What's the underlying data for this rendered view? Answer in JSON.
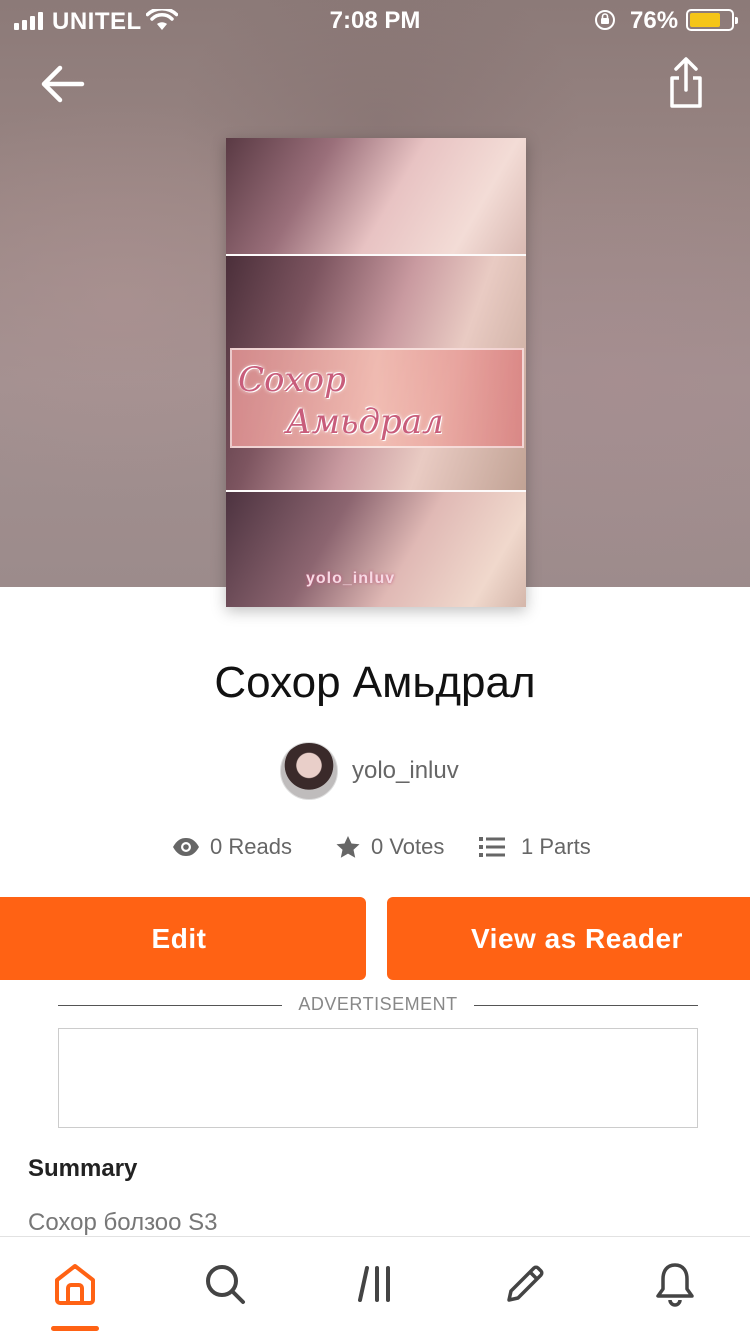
{
  "status_bar": {
    "carrier": "UNITEL",
    "time": "7:08 PM",
    "battery_percent": "76%",
    "battery_level": 0.76
  },
  "header": {
    "back_icon": "arrow-left-icon",
    "share_icon": "share-icon"
  },
  "cover": {
    "title_line_1": "Сохор",
    "title_line_2": "Амьдрал",
    "author_mark": "yolo_inluv"
  },
  "story": {
    "title": "Сохор Амьдрал",
    "author": "yolo_inluv"
  },
  "stats": {
    "reads": "0 Reads",
    "votes": "0 Votes",
    "parts": "1 Parts"
  },
  "actions": {
    "edit_label": "Edit",
    "view_as_reader_label": "View as Reader"
  },
  "advertisement": {
    "label": "ADVERTISEMENT"
  },
  "summary": {
    "heading": "Summary",
    "text": "Сохор болзоо S3"
  },
  "tab_bar": {
    "items": [
      {
        "name": "home",
        "icon": "home-icon",
        "active": true
      },
      {
        "name": "search",
        "icon": "search-icon",
        "active": false
      },
      {
        "name": "library",
        "icon": "library-icon",
        "active": false
      },
      {
        "name": "write",
        "icon": "pencil-icon",
        "active": false
      },
      {
        "name": "notifications",
        "icon": "bell-icon",
        "active": false
      }
    ],
    "accent_color": "#ff6214"
  },
  "colors": {
    "accent": "#ff6214",
    "battery": "#f5c518"
  }
}
